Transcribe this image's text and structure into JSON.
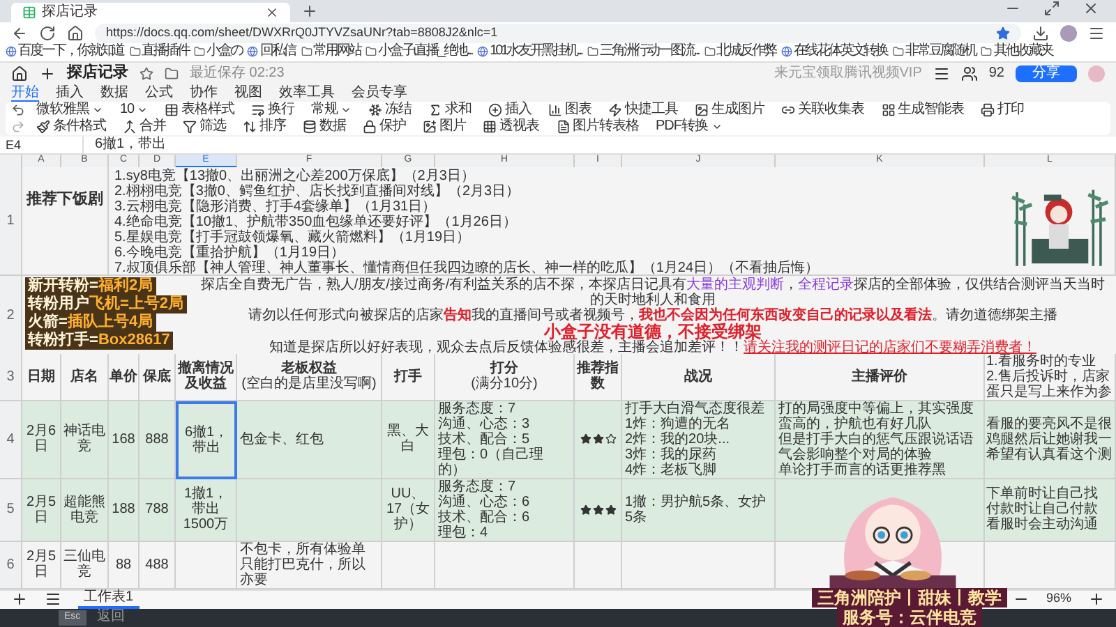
{
  "browser": {
    "tab_title": "探店记录",
    "url": "https://docs.qq.com/sheet/DWXRrQ0JTYVZsaUNr?tab=8808J2&nlc=1",
    "bookmarks": [
      "百度一下，你就知道",
      "直播插件",
      "小盒の",
      "回私信",
      "常用网站",
      "小盒子ɩ直播_绝地...",
      "101水友开黑挂机...",
      "三角洲行动一图流...",
      "北城反作弊",
      "在线花体英文转换",
      "非常豆腐随机",
      "其他收藏夹"
    ]
  },
  "doc": {
    "title": "探店记录",
    "save_status": "最近保存 02:23",
    "promo": "来元宝领取腾讯视频VIP",
    "user_count": "92",
    "share": "分享"
  },
  "menu_tabs": [
    {
      "label": "开始",
      "selected": true
    },
    {
      "label": "插入",
      "selected": false
    },
    {
      "label": "数据",
      "selected": false
    },
    {
      "label": "公式",
      "selected": false
    },
    {
      "label": "协作",
      "selected": false
    },
    {
      "label": "视图",
      "selected": false
    },
    {
      "label": "效率工具",
      "selected": false
    },
    {
      "label": "会员专享",
      "selected": false
    }
  ],
  "toolbar": {
    "row_1": [
      {
        "kind": "select",
        "label": "微软雅黑"
      },
      {
        "kind": "select",
        "label": "10"
      },
      {
        "kind": "tool",
        "label": "表格样式"
      },
      {
        "kind": "tool",
        "label": "换行"
      },
      {
        "kind": "select",
        "label": "常规"
      },
      {
        "kind": "tool",
        "label": "冻结"
      },
      {
        "kind": "tool",
        "label": "求和"
      },
      {
        "kind": "tool",
        "label": "插入"
      },
      {
        "kind": "tool",
        "label": "图表"
      },
      {
        "kind": "tool",
        "label": "快捷工具"
      },
      {
        "kind": "tool",
        "label": "生成图片"
      },
      {
        "kind": "tool",
        "label": "关联收集表"
      },
      {
        "kind": "tool",
        "label": "生成智能表"
      },
      {
        "kind": "tool",
        "label": "打印"
      }
    ],
    "row_2": [
      {
        "kind": "tool",
        "label": "条件格式"
      },
      {
        "kind": "tool",
        "label": "合并"
      },
      {
        "kind": "tool",
        "label": "筛选"
      },
      {
        "kind": "tool",
        "label": "排序"
      },
      {
        "kind": "tool",
        "label": "数据"
      },
      {
        "kind": "tool",
        "label": "保护"
      },
      {
        "kind": "tool",
        "label": "图片"
      },
      {
        "kind": "tool",
        "label": "透视表"
      },
      {
        "kind": "tool",
        "label": "图片转表格"
      },
      {
        "kind": "select",
        "label": "PDF转换"
      }
    ]
  },
  "formula_bar": {
    "cell": "E4",
    "value": "6撤1，带出"
  },
  "columns": [
    {
      "label": "A",
      "selected": false
    },
    {
      "label": "B",
      "selected": false
    },
    {
      "label": "C",
      "selected": false
    },
    {
      "label": "D",
      "selected": false
    },
    {
      "label": "E",
      "selected": true
    },
    {
      "label": "F",
      "selected": false
    },
    {
      "label": "G",
      "selected": false
    },
    {
      "label": "H",
      "selected": false
    },
    {
      "label": "I",
      "selected": false
    },
    {
      "label": "J",
      "selected": false
    },
    {
      "label": "K",
      "selected": false
    },
    {
      "label": "L",
      "selected": false
    }
  ],
  "row_1": {
    "number": "1",
    "title": "推荐下饭剧",
    "items": [
      "1.sy8电竞【13撤0、出丽洲之心差200万保底】（2月3日）",
      "2.栩栩电竞【3撤0、鳄鱼红护、店长找到直播间对线】（2月3日）",
      "3.云栩电竞【隐形消费、打手4套缘单】（1月31日）",
      "4.绝命电竞【10撤1、护航带350血包缘单还要好评】（1月26日）",
      "5.星娱电竞【打手冠鼓领爆氧、藏火箭燃料】（1月19日）",
      "6.今晚电竞【重拾护航】（1月19日）",
      "7.叔顶俱乐部【神人管理、神人董事长、懂情商但任我四边瞭的店长、神一样的吃瓜】（1月24日）（不看抽后悔）"
    ]
  },
  "notice": {
    "number": "2",
    "lines": [
      [
        {
          "kind": "plain",
          "text": "探店全自费无广告，熟人/朋友/接过商务/有利益关系的店不探，本探店日记具有"
        },
        {
          "kind": "purple",
          "text": "大量的主观判断"
        },
        {
          "kind": "plain",
          "text": "，"
        },
        {
          "kind": "purple",
          "text": "全程记录"
        },
        {
          "kind": "plain",
          "text": "探店的全部体验，仅供结合测评当天当时的天时地利人和食用"
        }
      ],
      [
        {
          "kind": "plain",
          "text": "请勿以任何形式向被探店的店家"
        },
        {
          "kind": "red",
          "text": "告知"
        },
        {
          "kind": "plain",
          "text": "我的直播间号或者视频号，"
        },
        {
          "kind": "red",
          "text": "我也不会因为任何东西改变自己的记录以及看法"
        },
        {
          "kind": "plain",
          "text": "。请勿道德绑架主播"
        }
      ],
      [
        {
          "kind": "alert",
          "text": "小盒子没有道德，不接受绑架"
        }
      ],
      [
        {
          "kind": "plain",
          "text": "知道是探店所以好好表现，观众去点后反馈体验感很差，主播会追加差评！！"
        },
        {
          "kind": "link",
          "text": "请关注我的测评日记的店家们不要糊弄消费者！"
        }
      ]
    ]
  },
  "header": {
    "number": "3",
    "cells": [
      {
        "label": "日期"
      },
      {
        "label": "店名"
      },
      {
        "label": "单价"
      },
      {
        "label": "保底"
      },
      {
        "label": "撤离情况及收益"
      },
      {
        "label": "老板权益",
        "sub": "(空白的是店里没写啊)"
      },
      {
        "label": "打手"
      },
      {
        "label": "打分",
        "sub": "(满分10分)"
      },
      {
        "label": "推荐指数"
      },
      {
        "label": "战况"
      },
      {
        "label": "主播评价"
      }
    ],
    "column_12": [
      "1.看服务时的专业",
      "2.售后投诉时，店家",
      "蛋只是写上来作为参"
    ]
  },
  "rows": [
    {
      "number": "4",
      "color": "#dcebe0",
      "selected": true,
      "date": "2月6日",
      "shop": "神话电竞",
      "price": "168",
      "minimum": "888",
      "result": "6撤1，带出",
      "perks": "包金卡、红包",
      "players": "黑、大白",
      "scores": [
        "服务态度：7",
        "沟通、心态：3",
        "技术、配合：5",
        "理包：0（自己理的）"
      ],
      "stars": 2,
      "battle": [
        "打手大白滑气态度很差",
        "1炸：狗遭的无名",
        "2炸：我的20块...",
        "3炸：我的尿药",
        "4炸：老板飞脚"
      ],
      "review": [
        "打的局强度中等偏上，其实强度蛮高的，护航也有好几队",
        "但是打手大白的惩气压跟说话语气会影响整个对局的体验",
        "单论打手而言的话更推荐黑"
      ],
      "notes": [
        "看服的要亮风不是很",
        "鸡腿然后让她谢我一",
        "希望有认真看这个测"
      ]
    },
    {
      "number": "5",
      "color": "#dcebe0",
      "selected": false,
      "date": "2月5日",
      "shop": "超能熊电竞",
      "price": "188",
      "minimum": "788",
      "result": "1撤1，带出1500万",
      "perks": "",
      "players": "UU、17（女护）",
      "scores": [
        "服务态度：7",
        "沟通、心态：6",
        "技术、配合：6",
        "理包：4"
      ],
      "stars": 3,
      "battle": [
        "1撤：男护航5条、女护5条"
      ],
      "review": [],
      "notes": [
        "下单前时让自己找",
        "付款时让自己付款",
        "看服时会主动沟通"
      ]
    },
    {
      "number": "6",
      "color": "#f4f4f4",
      "selected": false,
      "date": "2月5日",
      "shop": "三仙电竞",
      "price": "88",
      "minimum": "488",
      "result": "",
      "perks": "不包卡，所有体验单只能打巴克什，所以亦要",
      "players": "",
      "scores": [],
      "battle": [],
      "review": [],
      "notes": []
    }
  ],
  "sheet_bar": {
    "tabs": [
      {
        "label": "工作表1",
        "selected": true
      }
    ],
    "zoom": "96%"
  },
  "taskbar": {
    "key": "Esc",
    "label": "返回"
  },
  "overlay": {
    "promos": [
      {
        "left": "新开转粉=",
        "right": "福利2局"
      },
      {
        "left": "转粉用户",
        "right": "飞机=上号2局"
      },
      {
        "left": "火箭=",
        "right": "插队上号4局"
      },
      {
        "left": "转粉打手=",
        "right": "Box28617"
      }
    ],
    "caption": [
      "三角洲陪护丨甜妹丨教学",
      "服务号：云伴电竞"
    ]
  }
}
